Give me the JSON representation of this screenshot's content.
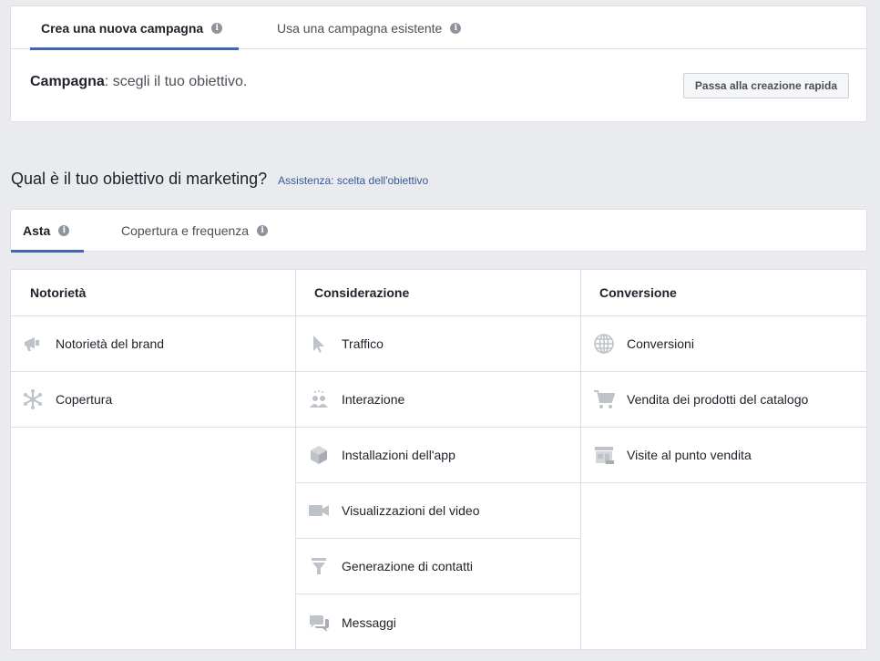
{
  "campaign_tabs": {
    "new": "Crea una nuova campagna",
    "existing": "Usa una campagna esistente"
  },
  "campaign_row": {
    "label": "Campagna",
    "text": ": scegli il tuo obiettivo.",
    "quick_button": "Passa alla creazione rapida"
  },
  "heading": {
    "title": "Qual è il tuo obiettivo di marketing?",
    "help_link": "Assistenza: scelta dell'obiettivo"
  },
  "buying_tabs": {
    "auction": "Asta",
    "reach_frequency": "Copertura e frequenza"
  },
  "columns": [
    {
      "title": "Notorietà",
      "items": [
        {
          "label": "Notorietà del brand",
          "icon": "megaphone-icon"
        },
        {
          "label": "Copertura",
          "icon": "reach-icon"
        }
      ]
    },
    {
      "title": "Considerazione",
      "items": [
        {
          "label": "Traffico",
          "icon": "cursor-icon"
        },
        {
          "label": "Interazione",
          "icon": "people-icon"
        },
        {
          "label": "Installazioni dell'app",
          "icon": "cube-icon"
        },
        {
          "label": "Visualizzazioni del video",
          "icon": "video-camera-icon"
        },
        {
          "label": "Generazione di contatti",
          "icon": "funnel-icon"
        },
        {
          "label": "Messaggi",
          "icon": "chat-bubbles-icon"
        }
      ]
    },
    {
      "title": "Conversione",
      "items": [
        {
          "label": "Conversioni",
          "icon": "globe-icon"
        },
        {
          "label": "Vendita dei prodotti del catalogo",
          "icon": "cart-icon"
        },
        {
          "label": "Visite al punto vendita",
          "icon": "store-icon"
        }
      ]
    }
  ],
  "colors": {
    "accent": "#4267b2",
    "icon": "#bec3c9",
    "link": "#365899"
  }
}
